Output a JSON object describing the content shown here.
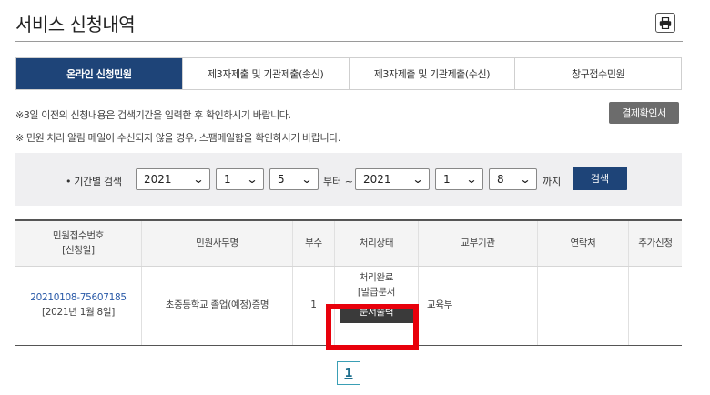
{
  "page": {
    "title": "서비스 신청내역"
  },
  "print": {
    "icon": "printer-icon"
  },
  "tabs": [
    {
      "label": "온라인 신청민원",
      "active": true
    },
    {
      "label": "제3자제출 및 기관제출(송신)",
      "active": false
    },
    {
      "label": "제3자제출 및 기관제출(수신)",
      "active": false
    },
    {
      "label": "창구접수민원",
      "active": false
    }
  ],
  "notes": {
    "note1": "※3일 이전의 신청내용은 검색기간을 입력한 후 확인하시기 바랍니다.",
    "note2": "※ 민원 처리 알림 메일이 수신되지 않을 경우, 스팸메일함을 확인하시기 바랍니다."
  },
  "receipt_button": "결제확인서",
  "search": {
    "label": "• 기간별 검색",
    "from_year": "2021",
    "from_month": "1",
    "from_day": "5",
    "from_text": "부터 ~",
    "to_year": "2021",
    "to_month": "1",
    "to_day": "8",
    "to_text": "까지",
    "button": "검색"
  },
  "table": {
    "headers": {
      "app_no": "민원접수번호",
      "app_date": "[신청일]",
      "name": "민원사무명",
      "copies": "부수",
      "status": "처리상태",
      "agency": "교부기관",
      "contact": "연락처",
      "extra": "추가신청"
    },
    "rows": [
      {
        "app_no": "20210108-75607185",
        "app_date": "[2021년 1월 8일]",
        "name": "초중등학교 졸업(예정)증명",
        "copies": "1",
        "status_line1": "처리완료",
        "status_line2": "[발급문서",
        "status_button": "문서출력",
        "agency": "교육부",
        "contact": "",
        "extra": ""
      }
    ]
  },
  "pagination": {
    "current": "1"
  },
  "colors": {
    "primary": "#1e4478",
    "highlight": "#e8000b",
    "link": "#2a5aa8"
  }
}
